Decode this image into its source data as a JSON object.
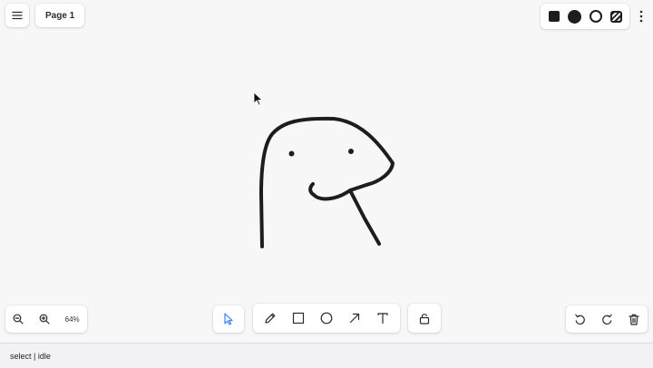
{
  "app": {
    "page_label": "Page 1"
  },
  "toolbar_top": {
    "menu_icon": "hamburger-menu-icon",
    "styles": [
      "filled-square",
      "filled-circle",
      "ring",
      "dashed-pattern"
    ],
    "more_icon": "vertical-ellipsis-icon"
  },
  "zoom": {
    "zoom_out_icon": "zoom-out-icon",
    "zoom_in_icon": "zoom-in-icon",
    "level": "64%"
  },
  "tools": {
    "select_icon": "cursor-arrow-icon",
    "items": [
      "pencil-icon",
      "rectangle-icon",
      "ellipse-icon",
      "arrow-icon",
      "text-icon"
    ],
    "lock_icon": "lock-icon",
    "active_color": "#3b82f6"
  },
  "history": {
    "undo_icon": "undo-icon",
    "redo_icon": "redo-icon",
    "delete_icon": "trash-icon"
  },
  "status": {
    "text": "select | idle"
  }
}
